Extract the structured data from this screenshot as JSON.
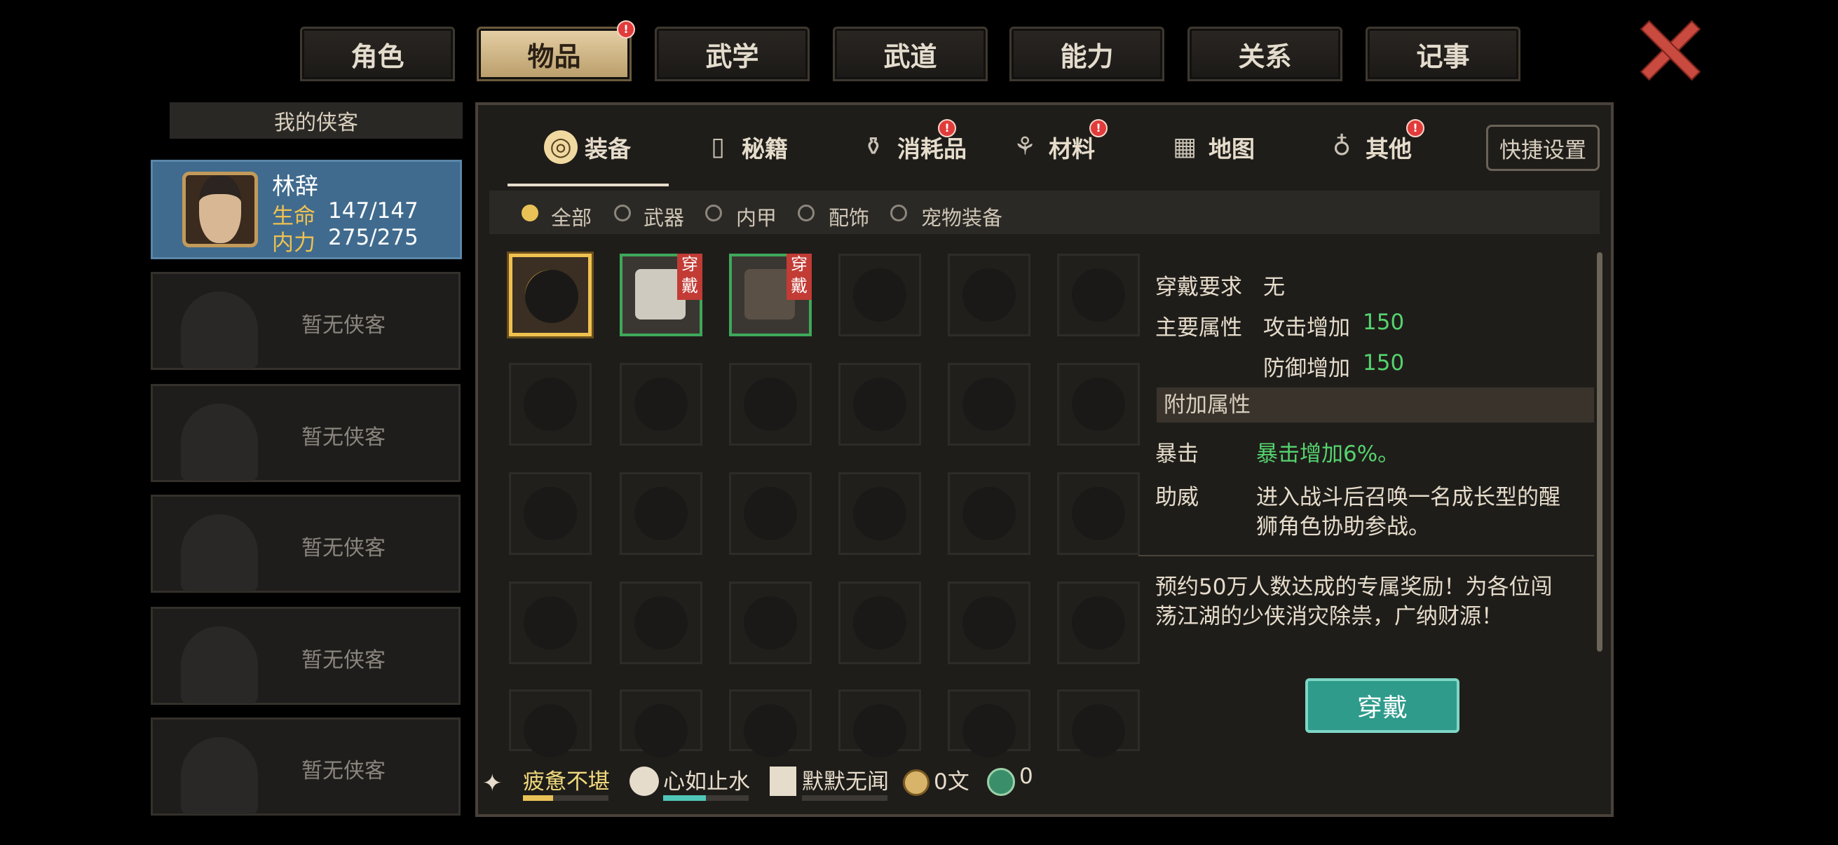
{
  "top_tabs": [
    {
      "label": "角色"
    },
    {
      "label": "物品",
      "badge": "!"
    },
    {
      "label": "武学"
    },
    {
      "label": "武道"
    },
    {
      "label": "能力"
    },
    {
      "label": "关系"
    },
    {
      "label": "记事"
    }
  ],
  "left": {
    "header": "我的侠客",
    "hero": {
      "name": "林辞",
      "hp_label": "生命",
      "hp": "147/147",
      "mp_label": "内力",
      "mp": "275/275"
    },
    "empty_slots": [
      "暂无侠客",
      "暂无侠客",
      "暂无侠客",
      "暂无侠客",
      "暂无侠客"
    ]
  },
  "categories": [
    {
      "label": "装备",
      "icon": "helmet-icon"
    },
    {
      "label": "秘籍",
      "icon": "book-icon"
    },
    {
      "label": "消耗品",
      "icon": "potion-icon",
      "badge": "!"
    },
    {
      "label": "材料",
      "icon": "herb-icon",
      "badge": "!"
    },
    {
      "label": "地图",
      "icon": "map-icon"
    },
    {
      "label": "其他",
      "icon": "lantern-icon",
      "badge": "!"
    }
  ],
  "shortcut_label": "快捷设置",
  "filters": [
    {
      "label": "全部",
      "selected": true
    },
    {
      "label": "武器"
    },
    {
      "label": "内甲"
    },
    {
      "label": "配饰"
    },
    {
      "label": "宠物装备"
    }
  ],
  "inventory": {
    "wear_tag": "穿戴",
    "items": [
      {
        "name": "lion-mask-icon",
        "selected": true
      },
      {
        "name": "gauntlet-icon",
        "worn": true
      },
      {
        "name": "robe-icon",
        "worn": true
      }
    ]
  },
  "detail": {
    "req_label": "穿戴要求",
    "req_value": "无",
    "main_label": "主要属性",
    "attr1_name": "攻击增加",
    "attr1_value": "150",
    "attr2_name": "防御增加",
    "attr2_value": "150",
    "extra_header": "附加属性",
    "crit_label": "暴击",
    "crit_value": "暴击增加6%。",
    "assist_label": "助威",
    "assist_line1": "进入战斗后召唤一名成长型的醒",
    "assist_line2": "狮角色协助参战。",
    "desc_line1": "预约50万人数达成的专属奖励！为各位闯",
    "desc_line2": "荡江湖的少侠消灾除祟，广纳财源！",
    "button": "穿戴"
  },
  "status": {
    "fatigue": "疲惫不堪",
    "fatigue_level": 0.35,
    "mood": "心如止水",
    "mood_level": 0.5,
    "fame": "默默无闻",
    "fame_level": 0.0,
    "money": "0文",
    "gems": "0"
  },
  "colors": {
    "accent_gold": "#e9c257",
    "green": "#55d36e",
    "badge_red": "#e23b3b",
    "button_teal": "#2e9b8b"
  }
}
